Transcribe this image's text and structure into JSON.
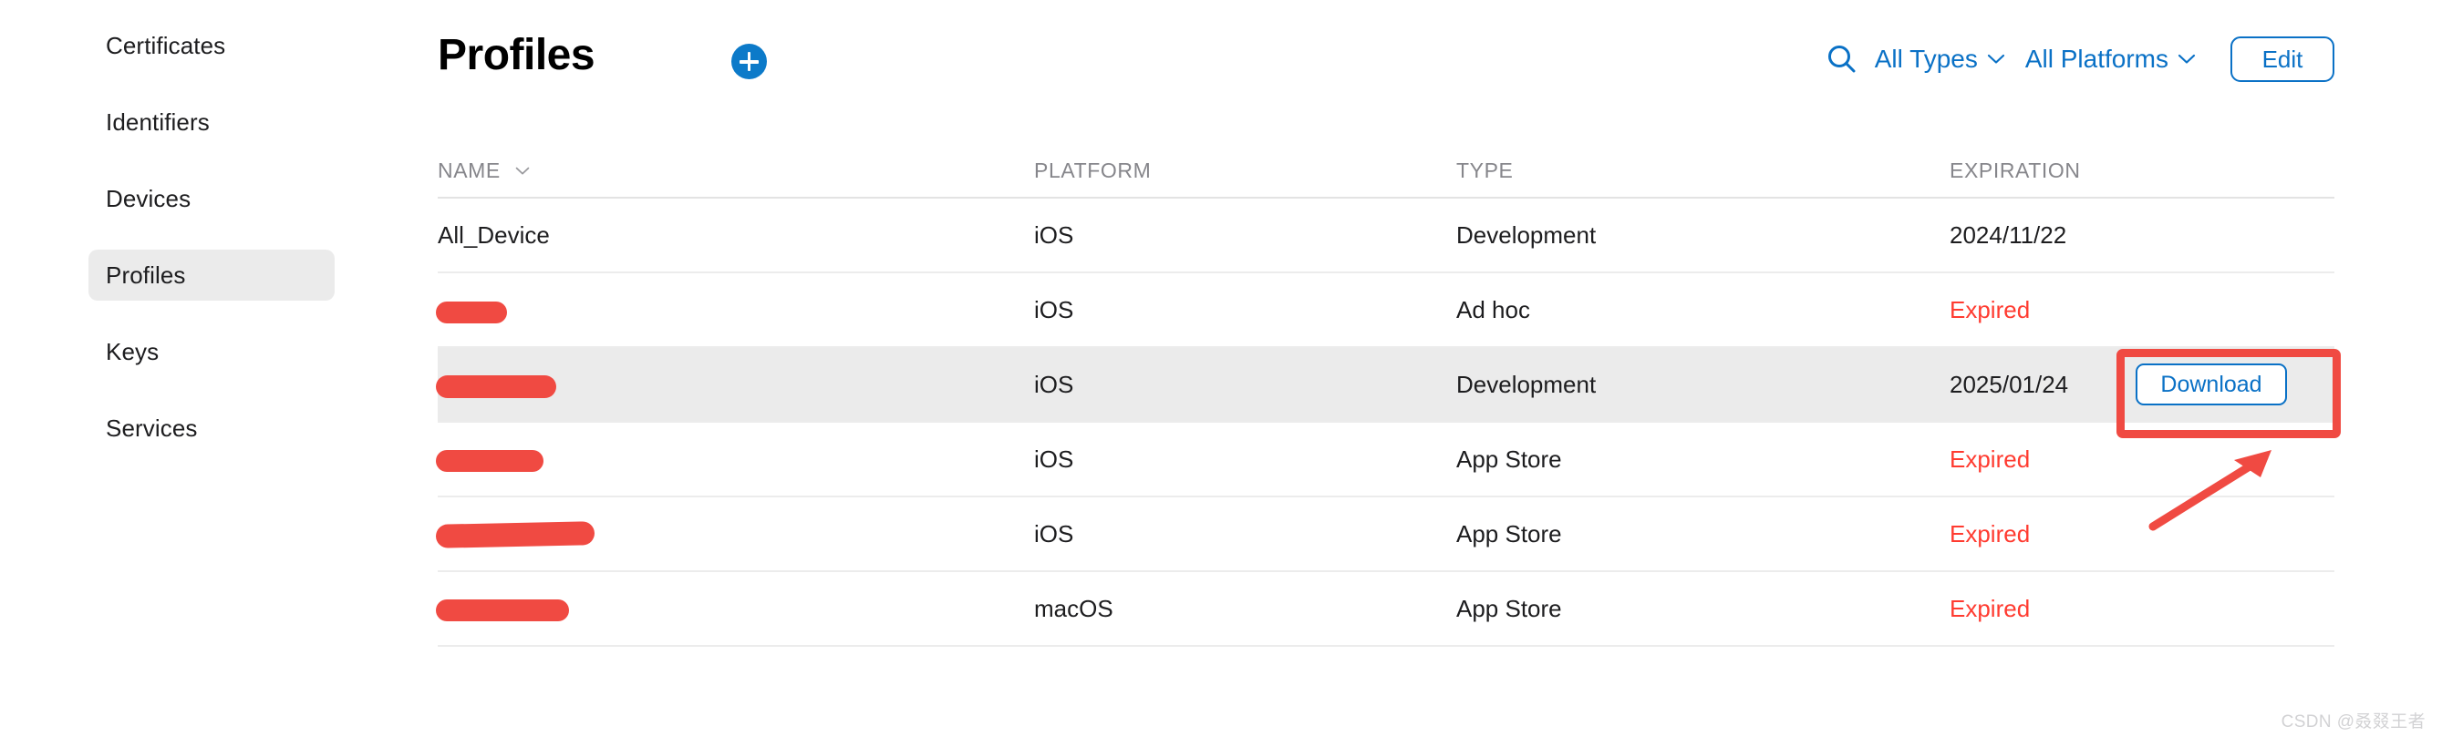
{
  "sidebar": {
    "items": [
      {
        "label": "Certificates",
        "selected": false
      },
      {
        "label": "Identifiers",
        "selected": false
      },
      {
        "label": "Devices",
        "selected": false
      },
      {
        "label": "Profiles",
        "selected": true
      },
      {
        "label": "Keys",
        "selected": false
      },
      {
        "label": "Services",
        "selected": false
      }
    ]
  },
  "header": {
    "title": "Profiles",
    "add_button_label": "+",
    "search_icon": "search-icon",
    "filters": [
      {
        "label": "All Types",
        "chevron": "⌄"
      },
      {
        "label": "All Platforms",
        "chevron": "⌄"
      }
    ],
    "edit_label": "Edit"
  },
  "table": {
    "columns": [
      {
        "key": "name",
        "label": "NAME",
        "sortable": true,
        "sort_chevron": "⌄"
      },
      {
        "key": "platform",
        "label": "PLATFORM",
        "sortable": false
      },
      {
        "key": "type",
        "label": "TYPE",
        "sortable": false
      },
      {
        "key": "expiration",
        "label": "EXPIRATION",
        "sortable": false
      }
    ],
    "rows": [
      {
        "name": "All_Device",
        "redacted": false,
        "platform": "iOS",
        "type": "Development",
        "expiration": "2024/11/22",
        "expired": false,
        "highlighted": false,
        "action": null
      },
      {
        "name": "",
        "redacted": true,
        "platform": "iOS",
        "type": "Ad hoc",
        "expiration": "Expired",
        "expired": true,
        "highlighted": false,
        "action": null
      },
      {
        "name": "",
        "redacted": true,
        "platform": "iOS",
        "type": "Development",
        "expiration": "2025/01/24",
        "expired": false,
        "highlighted": true,
        "action": "Download"
      },
      {
        "name": "",
        "redacted": true,
        "platform": "iOS",
        "type": "App Store",
        "expiration": "Expired",
        "expired": true,
        "highlighted": false,
        "action": null
      },
      {
        "name": "",
        "redacted": true,
        "platform": "iOS",
        "type": "App Store",
        "expiration": "Expired",
        "expired": true,
        "highlighted": false,
        "action": null
      },
      {
        "name": "",
        "redacted": true,
        "platform": "macOS",
        "type": "App Store",
        "expiration": "Expired",
        "expired": true,
        "highlighted": false,
        "action": null
      }
    ]
  },
  "annotations": {
    "download_highlight_box": true,
    "download_arrow": true,
    "accent_red": "#f04a42"
  },
  "watermark": {
    "text": "CSDN @叒叕王者"
  },
  "colors": {
    "link_blue": "#0a71c6",
    "add_blue": "#0c7ac9",
    "expired_red": "#ff3b30",
    "row_highlight": "#ebebeb",
    "header_gray": "#86868b",
    "divider": "#ececec"
  }
}
